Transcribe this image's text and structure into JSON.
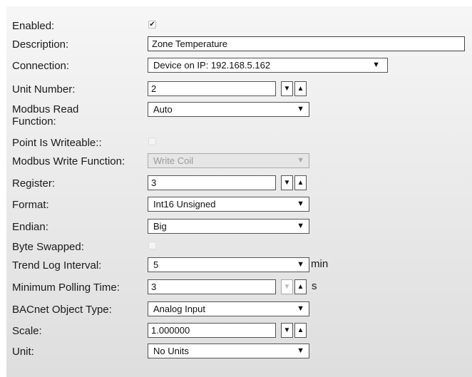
{
  "fields": {
    "enabled": {
      "label": "Enabled:",
      "checked": true,
      "mark": "✔"
    },
    "description": {
      "label": "Description:",
      "value": "Zone Temperature"
    },
    "connection": {
      "label": "Connection:",
      "value": "Device on IP: 192.168.5.162"
    },
    "unit_number": {
      "label": "Unit Number:",
      "value": "2"
    },
    "modbus_read_function": {
      "label": "Modbus Read Function:",
      "value": "Auto"
    },
    "point_is_writeable": {
      "label": "Point Is Writeable::",
      "checked": false
    },
    "modbus_write_function": {
      "label": "Modbus Write Function:",
      "value": "Write Coil",
      "disabled": true
    },
    "register": {
      "label": "Register:",
      "value": "3"
    },
    "format": {
      "label": "Format:",
      "value": "Int16 Unsigned"
    },
    "endian": {
      "label": "Endian:",
      "value": "Big"
    },
    "byte_swapped": {
      "label": "Byte Swapped:",
      "checked": false
    },
    "trend_log_interval": {
      "label": "Trend Log Interval:",
      "value": "5",
      "unit": "min"
    },
    "minimum_polling_time": {
      "label": "Minimum Polling Time:",
      "value": "3",
      "unit": "s"
    },
    "bacnet_object_type": {
      "label": "BACnet Object Type:",
      "value": "Analog Input"
    },
    "scale": {
      "label": "Scale:",
      "value": "1.000000"
    },
    "unit": {
      "label": "Unit:",
      "value": "No Units"
    }
  },
  "icons": {
    "down": "▼",
    "up": "▲"
  },
  "colors": {
    "disabled_bg": "#e6e6e6",
    "disabled_text": "#999999"
  }
}
